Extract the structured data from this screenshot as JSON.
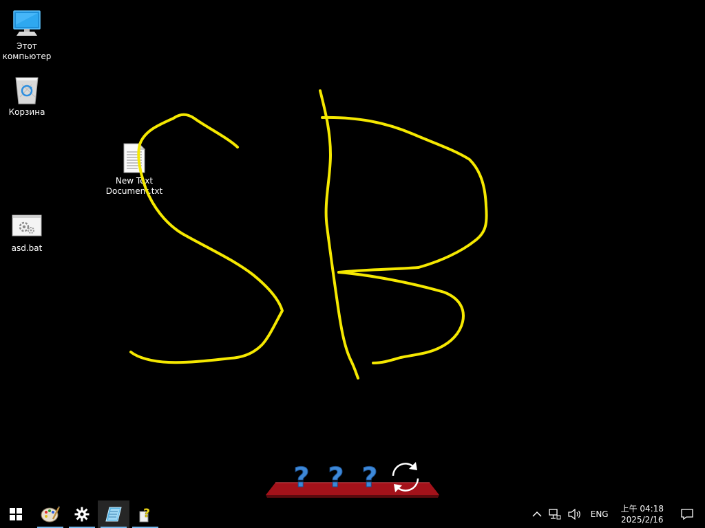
{
  "desktop": {
    "icons": [
      {
        "label": "Этот компьютер",
        "icon": "this-pc-icon"
      },
      {
        "label": "Корзина",
        "icon": "recycle-bin-icon"
      },
      {
        "label": "New Text Document.txt",
        "icon": "text-file-icon"
      },
      {
        "label": "asd.bat",
        "icon": "batch-file-icon"
      }
    ],
    "drawing": {
      "text": "SB",
      "color": "#f5e800"
    },
    "dock": {
      "items": [
        {
          "icon": "question-mark-icon"
        },
        {
          "icon": "question-mark-icon"
        },
        {
          "icon": "question-mark-icon"
        },
        {
          "icon": "refresh-icon"
        }
      ],
      "shelf_color": "#a3121a"
    }
  },
  "taskbar": {
    "buttons": [
      {
        "icon": "windows-start-icon"
      },
      {
        "icon": "paint-palette-icon"
      },
      {
        "icon": "settings-gear-icon"
      },
      {
        "icon": "notepad-icon"
      },
      {
        "icon": "help-file-icon"
      }
    ],
    "accent_color": "#76b9ed",
    "tray": {
      "icons": [
        "chevron-up-icon",
        "network-icon",
        "volume-icon"
      ],
      "language": "ENG",
      "time": "上午 04:18",
      "date": "2025/2/16",
      "notification_icon": "action-center-icon"
    }
  }
}
